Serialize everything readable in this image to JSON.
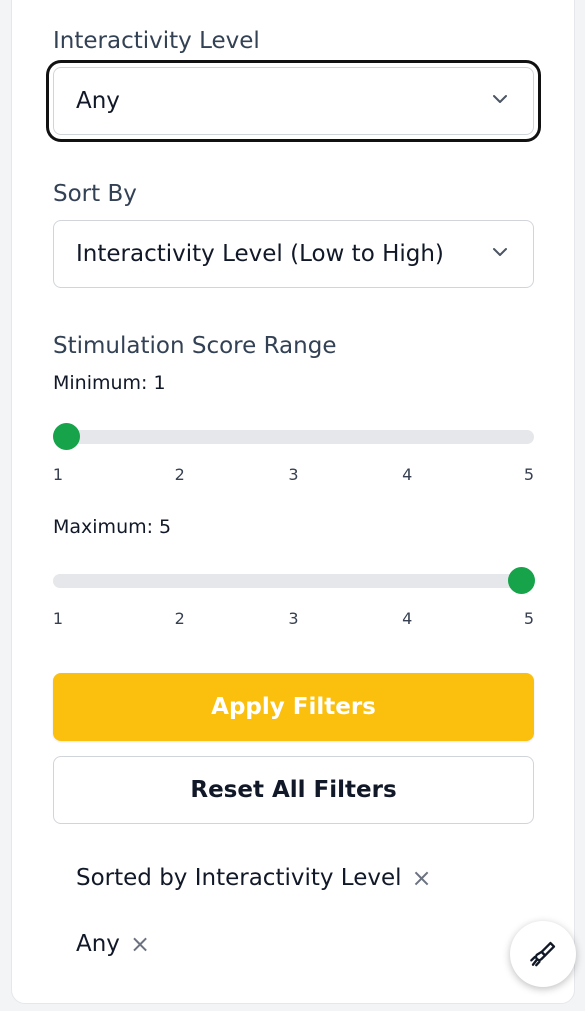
{
  "interactivity": {
    "label": "Interactivity Level",
    "value": "Any"
  },
  "sort": {
    "label": "Sort By",
    "value": "Interactivity Level (Low to High)"
  },
  "stimulation": {
    "label": "Stimulation Score Range",
    "min_label": "Minimum:",
    "min_value": "1",
    "max_label": "Maximum:",
    "max_value": "5",
    "range": [
      1,
      5
    ],
    "ticks": [
      "1",
      "2",
      "3",
      "4",
      "5"
    ]
  },
  "buttons": {
    "apply": "Apply Filters",
    "reset": "Reset All Filters"
  },
  "active_filters": [
    {
      "label": "Sorted by Interactivity Level"
    },
    {
      "label": "Any"
    }
  ],
  "icons": {
    "remove": "×",
    "chevron": "chevron-down-icon",
    "fab": "paintbrush-icon"
  },
  "colors": {
    "accent": "#fbbf0d",
    "slider_thumb": "#16a34a",
    "track": "#e5e7eb"
  }
}
